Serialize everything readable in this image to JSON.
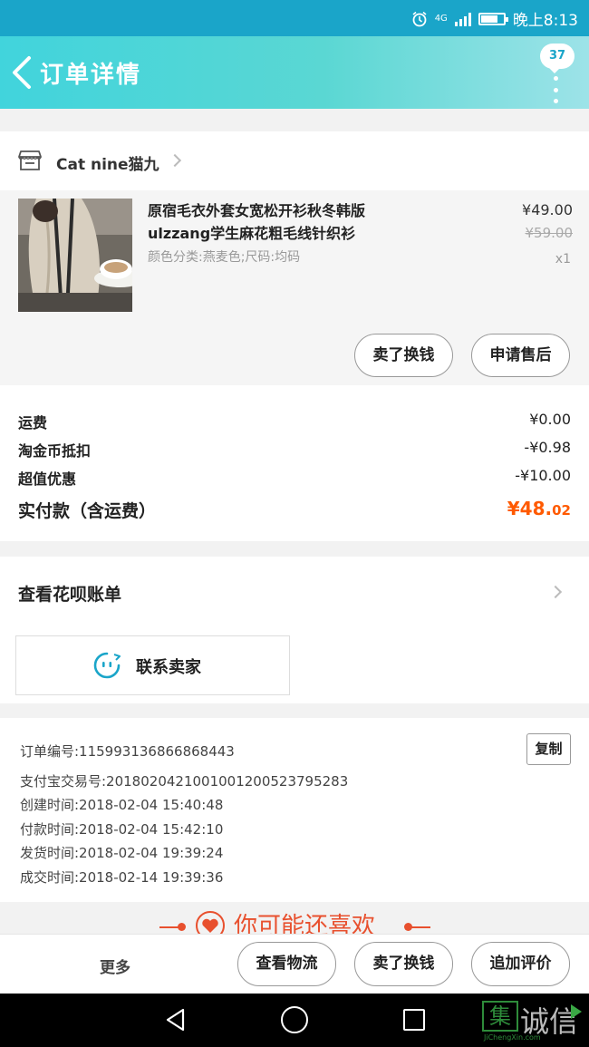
{
  "status_bar": {
    "network": "4G",
    "time": "晚上8:13"
  },
  "header": {
    "title": "订单详情",
    "badge_count": "37"
  },
  "shop": {
    "name": "Cat nine猫九"
  },
  "product": {
    "title": "原宿毛衣外套女宽松开衫秋冬韩版ulzzang学生麻花粗毛线针织衫",
    "spec": "颜色分类:燕麦色;尺码:均码",
    "price": "¥49.00",
    "original_price": "¥59.00",
    "quantity": "x1",
    "buttons": {
      "exchange": "卖了换钱",
      "after_sales": "申请售后"
    }
  },
  "totals": {
    "shipping_label": "运费",
    "shipping_value": "¥0.00",
    "coin_label": "淘金币抵扣",
    "coin_value": "-¥0.98",
    "discount_label": "超值优惠",
    "discount_value": "-¥10.00",
    "paid_label": "实付款（含运费）",
    "paid_value_main": "¥48.",
    "paid_value_decimal": "02"
  },
  "huabei": {
    "label": "查看花呗账单",
    "contact_label": "联系卖家"
  },
  "order_info": {
    "order_no": "订单编号:115993136866868443",
    "copy_label": "复制",
    "alipay_no": "支付宝交易号:2018020421001001200523795283",
    "created": "创建时间:2018-02-04 15:40:48",
    "paid": "付款时间:2018-02-04 15:42:10",
    "shipped": "发货时间:2018-02-04 19:39:24",
    "completed": "成交时间:2018-02-14 19:39:36"
  },
  "recommend": {
    "title": "你可能还喜欢"
  },
  "bottom_bar": {
    "more": "更多",
    "logistics": "查看物流",
    "exchange": "卖了换钱",
    "review": "追加评价"
  },
  "watermark": {
    "char": "集",
    "name": "诚信",
    "sub": "JiChengXin.com"
  },
  "colors": {
    "accent": "#1aa5c9",
    "price_orange": "#ff5a00",
    "recommend_red": "#e8502e"
  }
}
